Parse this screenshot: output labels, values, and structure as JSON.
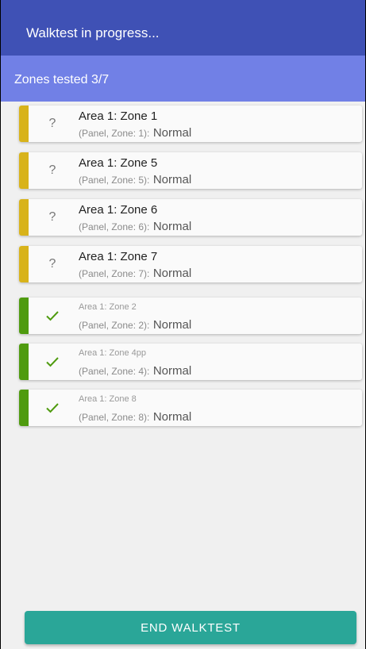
{
  "app_bar": {
    "title": "Walktest in progress..."
  },
  "sub_bar": {
    "progress_text": "Zones tested 3/7"
  },
  "colors": {
    "pending": "#d8b31a",
    "tested": "#4f9b0f",
    "primary": "#3f51b5",
    "secondary": "#7180e6",
    "button": "#2aa698"
  },
  "zones": [
    {
      "status": "pending",
      "icon": "question-icon",
      "name": "Area 1: Zone 1",
      "panel": "(Panel, Zone: 1):",
      "state": "Normal"
    },
    {
      "status": "pending",
      "icon": "question-icon",
      "name": "Area 1: Zone 5",
      "panel": "(Panel, Zone: 5):",
      "state": "Normal"
    },
    {
      "status": "pending",
      "icon": "question-icon",
      "name": "Area 1: Zone 6",
      "panel": "(Panel, Zone: 6):",
      "state": "Normal"
    },
    {
      "status": "pending",
      "icon": "question-icon",
      "name": "Area 1: Zone 7",
      "panel": "(Panel, Zone: 7):",
      "state": "Normal"
    },
    {
      "status": "tested",
      "icon": "check-icon",
      "name": "Area 1: Zone 2",
      "panel": "(Panel, Zone: 2):",
      "state": "Normal"
    },
    {
      "status": "tested",
      "icon": "check-icon",
      "name": "Area 1: Zone 4pp",
      "panel": "(Panel, Zone: 4):",
      "state": "Normal"
    },
    {
      "status": "tested",
      "icon": "check-icon",
      "name": "Area 1: Zone 8",
      "panel": "(Panel, Zone: 8):",
      "state": "Normal"
    }
  ],
  "footer": {
    "end_button": "END WALKTEST"
  }
}
